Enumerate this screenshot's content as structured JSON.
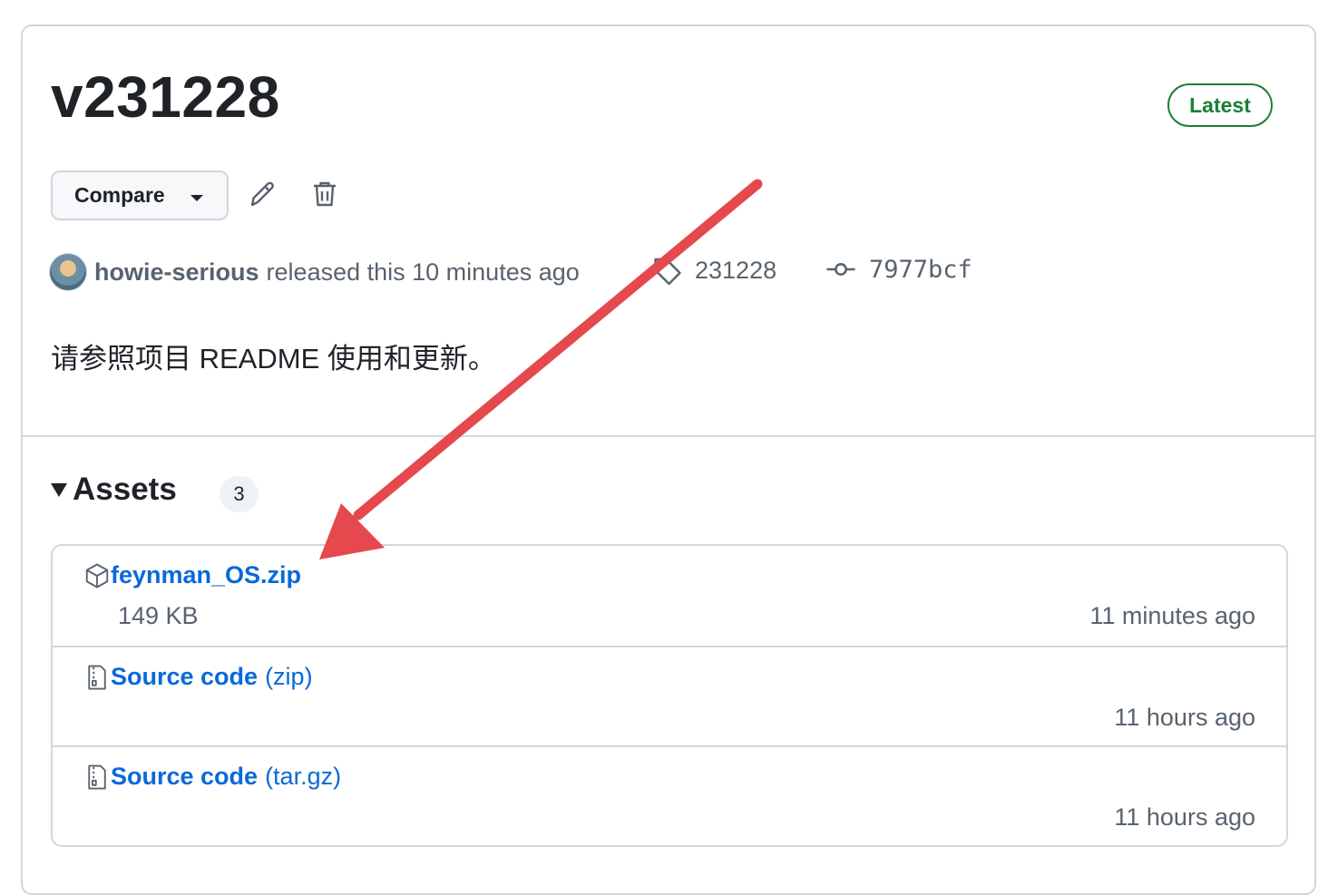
{
  "release": {
    "title": "v231228",
    "latest_badge": "Latest",
    "compare_label": "Compare",
    "author": "howie-serious",
    "released_text": "released this 10 minutes ago",
    "tag": "231228",
    "commit": "7977bcf",
    "description": "请参照项目 README 使用和更新。"
  },
  "assets": {
    "heading": "Assets",
    "count": "3",
    "items": [
      {
        "name": "feynman_OS.zip",
        "ext": "",
        "size": "149 KB",
        "time": "11 minutes ago",
        "icon": "package-icon"
      },
      {
        "name": "Source code",
        "ext": "(zip)",
        "size": "",
        "time": "11 hours ago",
        "icon": "file-zip-icon"
      },
      {
        "name": "Source code",
        "ext": "(tar.gz)",
        "size": "",
        "time": "11 hours ago",
        "icon": "file-zip-icon"
      }
    ]
  },
  "colors": {
    "link": "#0969da",
    "latest": "#1a7f37",
    "annotation_arrow": "#e5484d"
  }
}
